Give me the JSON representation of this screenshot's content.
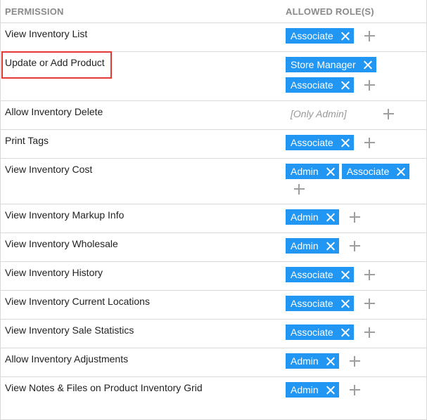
{
  "header": {
    "permission": "PERMISSION",
    "allowed_roles": "ALLOWED ROLE(S)"
  },
  "rows": [
    {
      "label": "View Inventory List",
      "roles": [
        "Associate"
      ],
      "only": ""
    },
    {
      "label": "Update or Add Product",
      "roles": [
        "Store Manager",
        "Associate"
      ],
      "only": ""
    },
    {
      "label": "Allow Inventory Delete",
      "roles": [],
      "only": "[Only Admin]"
    },
    {
      "label": "Print Tags",
      "roles": [
        "Associate"
      ],
      "only": ""
    },
    {
      "label": "View Inventory Cost",
      "roles": [
        "Admin",
        "Associate"
      ],
      "only": ""
    },
    {
      "label": "View Inventory Markup Info",
      "roles": [
        "Admin"
      ],
      "only": ""
    },
    {
      "label": "View Inventory Wholesale",
      "roles": [
        "Admin"
      ],
      "only": ""
    },
    {
      "label": "View Inventory History",
      "roles": [
        "Associate"
      ],
      "only": ""
    },
    {
      "label": "View Inventory Current Locations",
      "roles": [
        "Associate"
      ],
      "only": ""
    },
    {
      "label": "View Inventory Sale Statistics",
      "roles": [
        "Associate"
      ],
      "only": ""
    },
    {
      "label": "Allow Inventory Adjustments",
      "roles": [
        "Admin"
      ],
      "only": ""
    },
    {
      "label": "View Notes & Files on Product Inventory Grid",
      "roles": [
        "Admin"
      ],
      "only": ""
    }
  ],
  "colors": {
    "chip": "#2196f3",
    "highlight": "#e53935",
    "plus": "#9e9e9e"
  },
  "icons": {
    "remove": "close-icon",
    "add": "plus-icon"
  }
}
